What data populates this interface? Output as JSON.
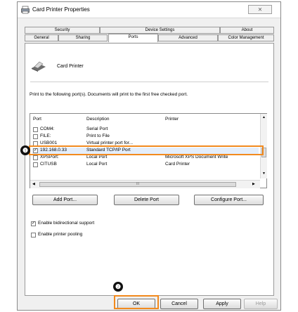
{
  "window": {
    "title": "Card Printer Properties",
    "close_glyph": "⨯"
  },
  "tabs_top": [
    "Security",
    "Device Settings",
    "About"
  ],
  "tabs_bottom": [
    "General",
    "Sharing",
    "Ports",
    "Advanced",
    "Color Management"
  ],
  "header": {
    "printer_name": "Card Printer"
  },
  "instructions": "Print to the following port(s). Documents will print to the first free checked port.",
  "table": {
    "columns": [
      "Port",
      "Description",
      "Printer"
    ],
    "rows": [
      {
        "port": "COM4:",
        "description": "Serial Port",
        "printer": "",
        "checked": false
      },
      {
        "port": "FILE:",
        "description": "Print to File",
        "printer": "",
        "checked": false
      },
      {
        "port": "USB001",
        "description": "Virtual printer port for...",
        "printer": "",
        "checked": false
      },
      {
        "port": "192.168.0.33",
        "description": "Standard TCP/IP Port",
        "printer": "",
        "checked": true
      },
      {
        "port": "XPSPort:",
        "description": "Local Port",
        "printer": "Microsoft XPS Document Write",
        "checked": false
      },
      {
        "port": "CITUSB",
        "description": "Local Port",
        "printer": "Card Printer",
        "checked": false
      }
    ],
    "hscroll_mid": "III"
  },
  "buttons": {
    "add_port": "Add Port...",
    "delete_port": "Delete Port",
    "configure_port": "Configure Port..."
  },
  "options": {
    "bidirectional": {
      "label": "Enable bidirectional support",
      "checked": true
    },
    "pooling": {
      "label": "Enable printer pooling",
      "checked": false
    }
  },
  "footer": {
    "ok": "OK",
    "cancel": "Cancel",
    "apply": "Apply",
    "help": "Help"
  },
  "markers": [
    "❶",
    "❷"
  ],
  "colors": {
    "highlight": "#f28a1e"
  }
}
